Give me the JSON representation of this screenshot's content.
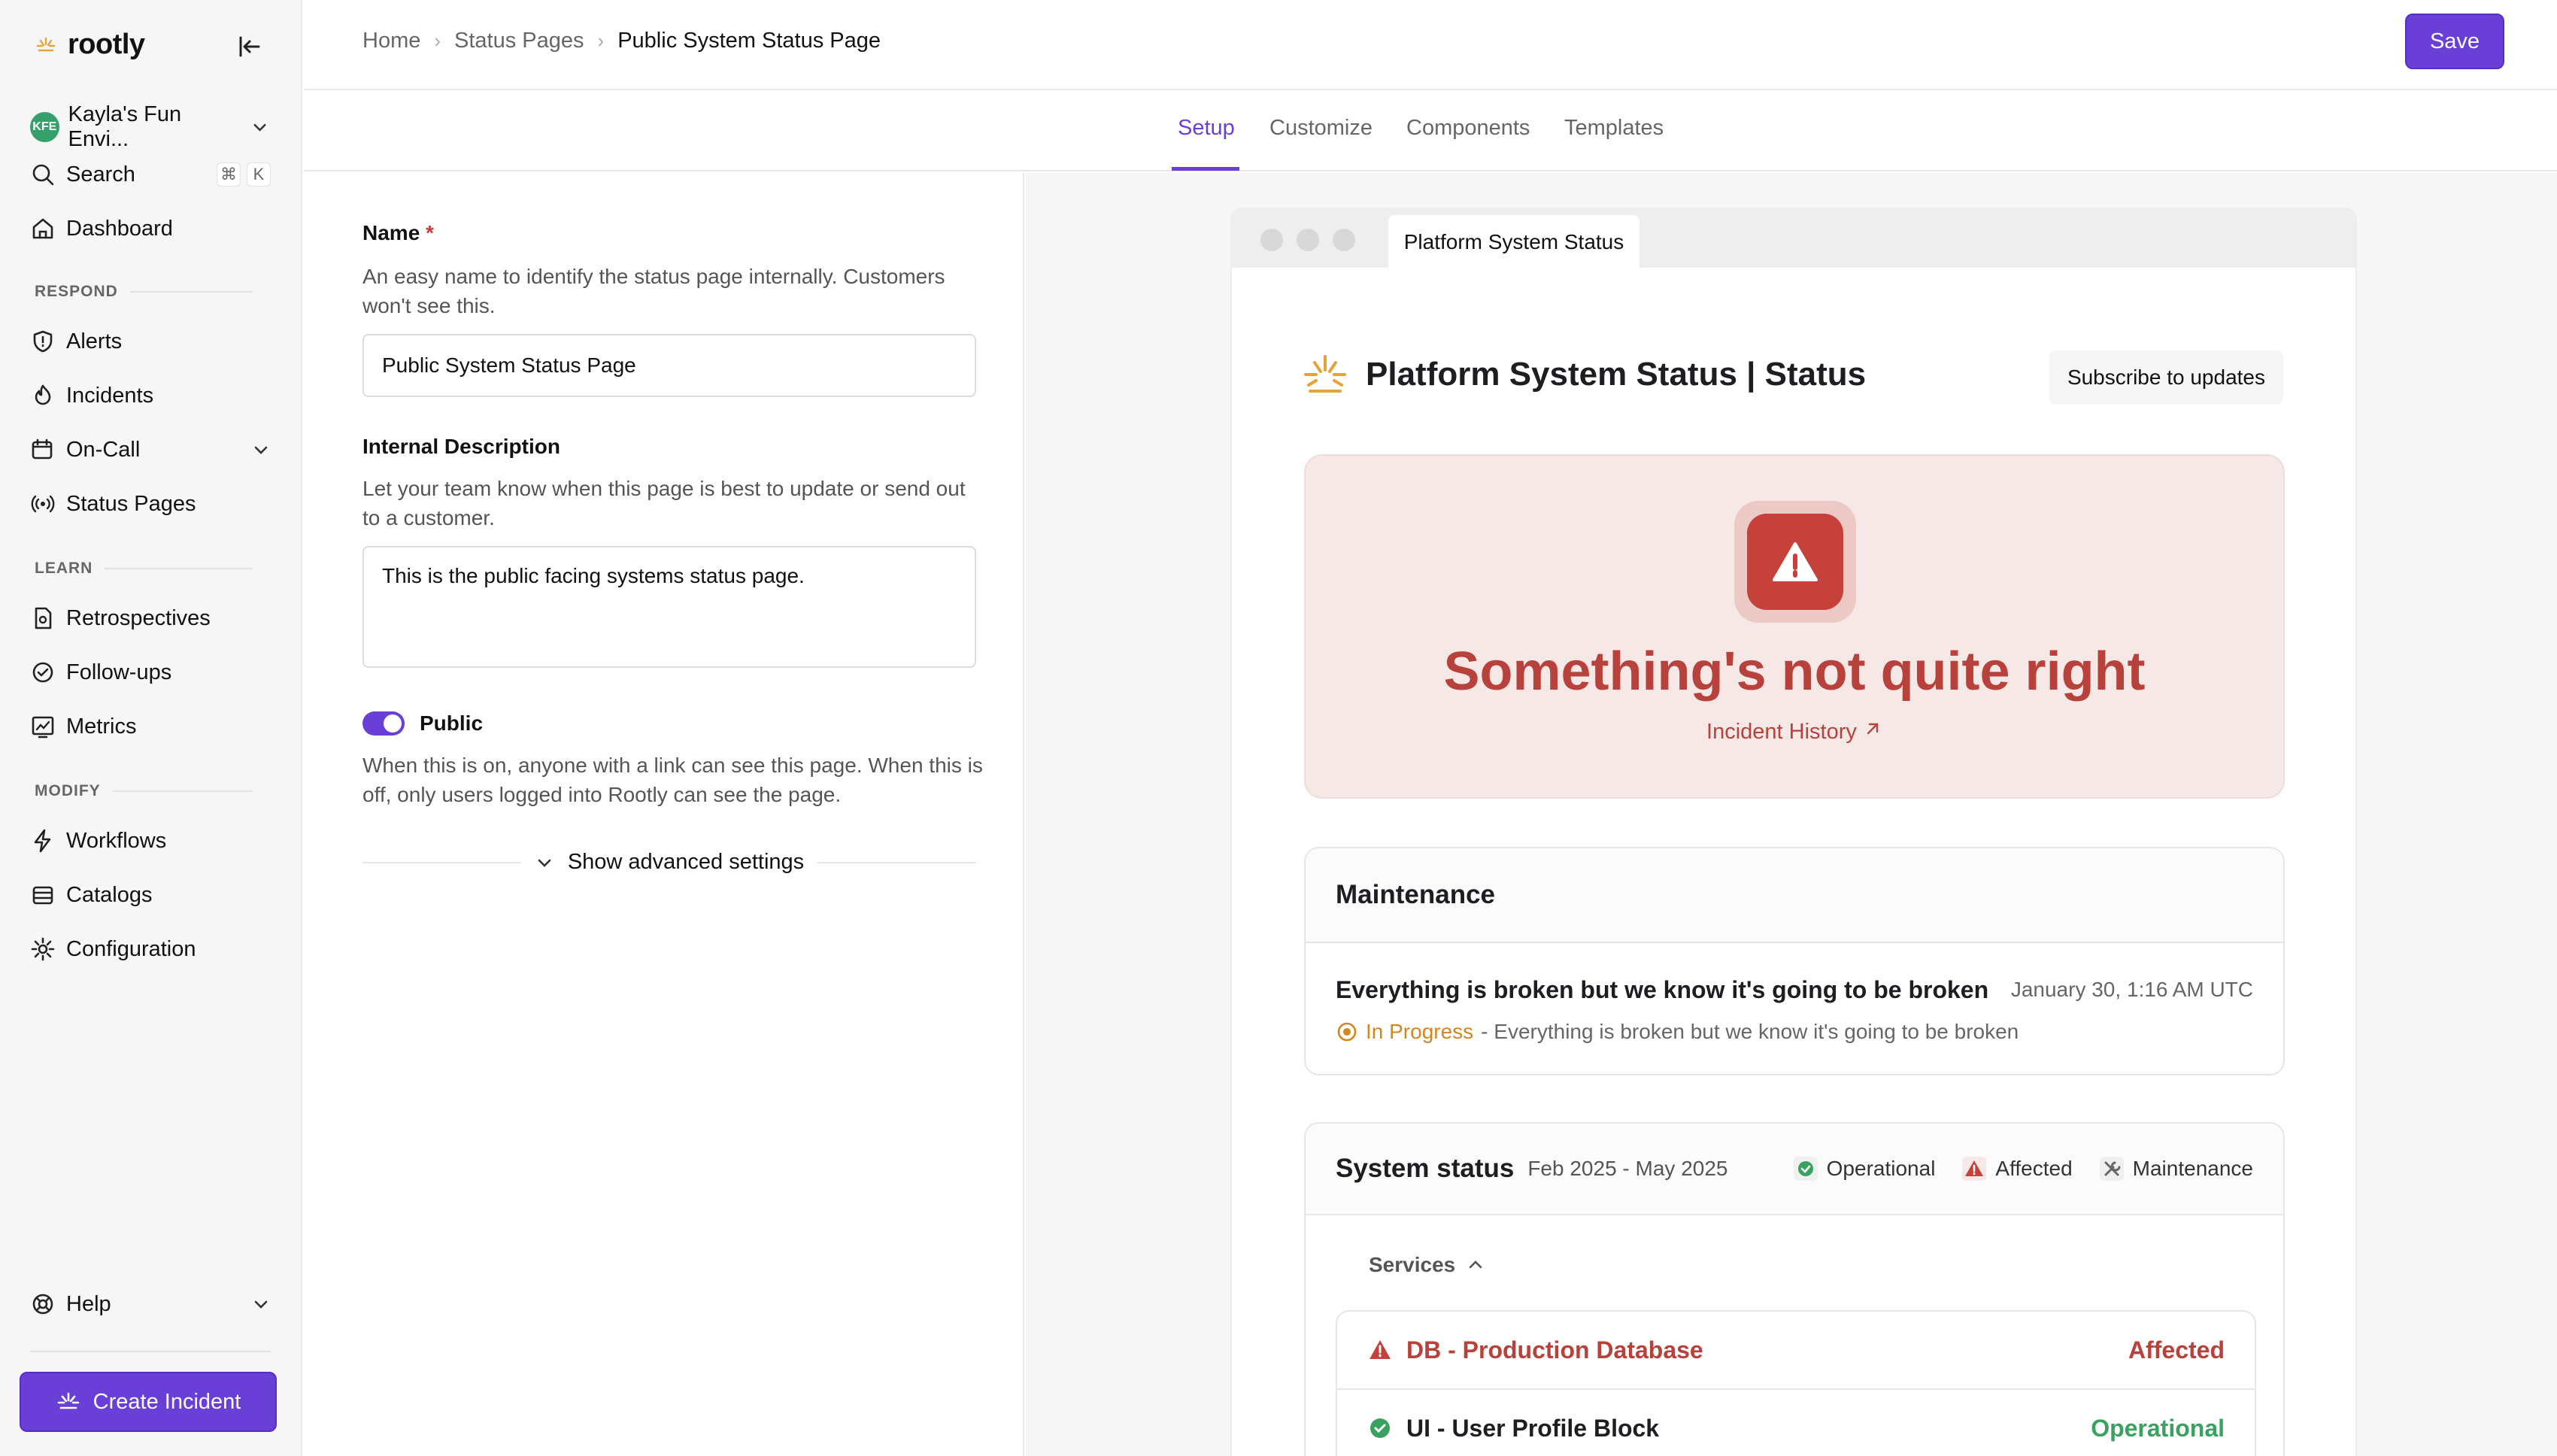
{
  "sidebar": {
    "brand": "rootly",
    "environment": {
      "initials": "KFE",
      "name": "Kayla's Fun Envi..."
    },
    "search": {
      "label": "Search",
      "shortcut_cmd": "⌘",
      "shortcut_key": "K"
    },
    "dashboard": "Dashboard",
    "respond_heading": "RESPOND",
    "respond_items": [
      "Alerts",
      "Incidents",
      "On-Call",
      "Status Pages"
    ],
    "learn_heading": "LEARN",
    "learn_items": [
      "Retrospectives",
      "Follow-ups",
      "Metrics"
    ],
    "modify_heading": "MODIFY",
    "modify_items": [
      "Workflows",
      "Catalogs",
      "Configuration"
    ],
    "help": "Help",
    "create_incident": "Create Incident"
  },
  "header": {
    "breadcrumbs": [
      "Home",
      "Status Pages",
      "Public System Status Page"
    ],
    "save": "Save"
  },
  "tabs": [
    {
      "label": "Setup",
      "active": true
    },
    {
      "label": "Customize",
      "active": false
    },
    {
      "label": "Components",
      "active": false
    },
    {
      "label": "Templates",
      "active": false
    }
  ],
  "form": {
    "name_label": "Name",
    "name_required": "*",
    "name_help": "An easy name to identify the status page internally. Customers won't see this.",
    "name_value": "Public System Status Page",
    "desc_label": "Internal Description",
    "desc_help": "Let your team know when this page is best to update or send out to a customer.",
    "desc_value": "This is the public facing systems status page.",
    "public_label": "Public",
    "public_on": true,
    "public_help": "When this is on, anyone with a link can see this page. When this is off, only users logged into Rootly can see the page.",
    "advanced": "Show advanced settings"
  },
  "preview": {
    "browser_tab": "Platform System Status",
    "page_title": "Platform System Status | Status",
    "subscribe": "Subscribe to updates",
    "alert_message": "Something's not quite right",
    "incident_history": "Incident History",
    "maintenance": {
      "heading": "Maintenance",
      "title": "Everything is broken but we know it's going to be broken",
      "date": "January 30, 1:16 AM UTC",
      "state": "In Progress",
      "detail": "- Everything is broken but we know it's going to be broken"
    },
    "system_status": {
      "heading": "System status",
      "range": "Feb 2025 - May 2025",
      "legend": [
        "Operational",
        "Affected",
        "Maintenance"
      ],
      "services_label": "Services",
      "services": [
        {
          "name": "DB - Production Database",
          "status": "Affected"
        },
        {
          "name": "UI - User Profile Block",
          "status": "Operational"
        }
      ]
    }
  },
  "colors": {
    "accent": "#6a3fd8",
    "affected": "#b8423b",
    "operational": "#3aa25f",
    "in_progress": "#d4861f"
  }
}
